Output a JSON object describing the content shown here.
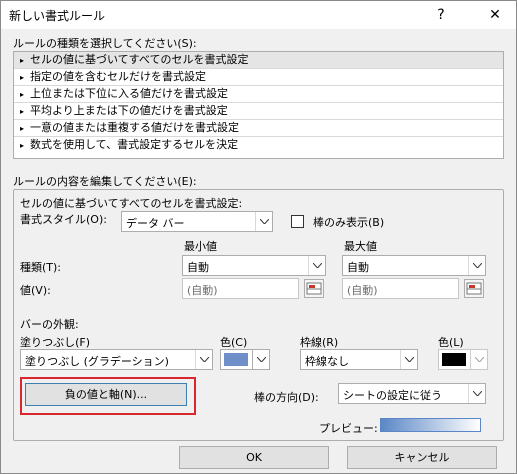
{
  "window": {
    "title": "新しい書式ルール",
    "help_label": "?",
    "close_label": "✕"
  },
  "rule_type": {
    "label": "ルールの種類を選択してください(S):",
    "items": [
      "セルの値に基づいてすべてのセルを書式設定",
      "指定の値を含むセルだけを書式設定",
      "上位または下位に入る値だけを書式設定",
      "平均より上または下の値だけを書式設定",
      "一意の値または重複する値だけを書式設定",
      "数式を使用して、書式設定するセルを決定"
    ],
    "bullet": "▸"
  },
  "rule_edit": {
    "label": "ルールの内容を編集してください(E):",
    "heading": "セルの値に基づいてすべてのセルを書式設定:",
    "format_style_label": "書式スタイル(O):",
    "format_style_value": "データ バー",
    "show_bar_only_label": "棒のみ表示(B)",
    "min_label": "最小値",
    "max_label": "最大値",
    "type_label": "種類(T):",
    "value_label": "値(V):",
    "min_type": "自動",
    "max_type": "自動",
    "min_value": "(自動)",
    "max_value": "(自動)",
    "appearance_label": "バーの外観:",
    "fill_label": "塗りつぶし(F)",
    "fill_value": "塗りつぶし (グラデーション)",
    "color_label_1": "色(C)",
    "border_label": "枠線(R)",
    "border_value": "枠線なし",
    "color_label_2": "色(L)",
    "negative_axis_button": "負の値と軸(N)...",
    "bar_direction_label": "棒の方向(D):",
    "bar_direction_value": "シートの設定に従う",
    "preview_label": "プレビュー:"
  },
  "colors": {
    "fill_color": "#6f8fc9",
    "border_color": "#000000",
    "highlight": "#d9272d"
  },
  "buttons": {
    "ok": "OK",
    "cancel": "キャンセル"
  }
}
